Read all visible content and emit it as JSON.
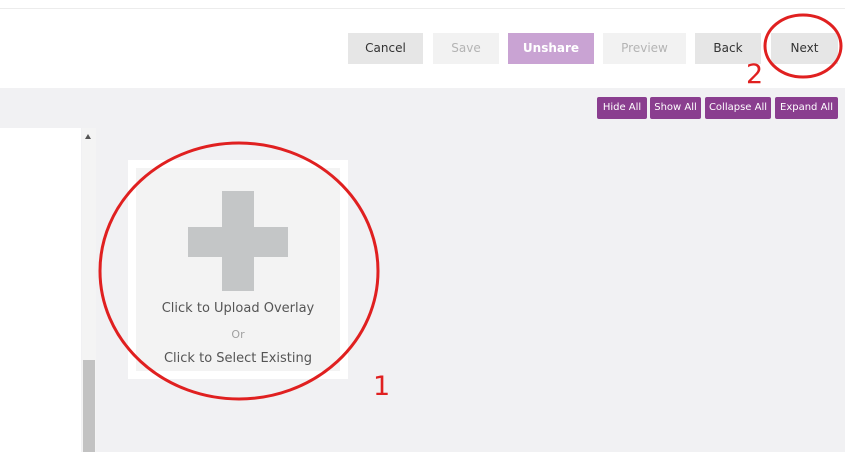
{
  "toolbar": {
    "cancel": "Cancel",
    "save": "Save",
    "unshare": "Unshare",
    "preview": "Preview",
    "back": "Back",
    "next": "Next"
  },
  "controls": {
    "hide_all": "Hide All",
    "show_all": "Show All",
    "collapse_all": "Collapse All",
    "expand_all": "Expand All"
  },
  "upload": {
    "upload_label": "Click to Upload Overlay",
    "or_label": "Or",
    "select_label": "Click to Select Existing"
  },
  "annotations": {
    "step1": "1",
    "step2": "2"
  },
  "colors": {
    "accent_purple": "#8a3e8f",
    "unshare_purple": "#c9a3d3",
    "annotation_red": "#e02020"
  }
}
